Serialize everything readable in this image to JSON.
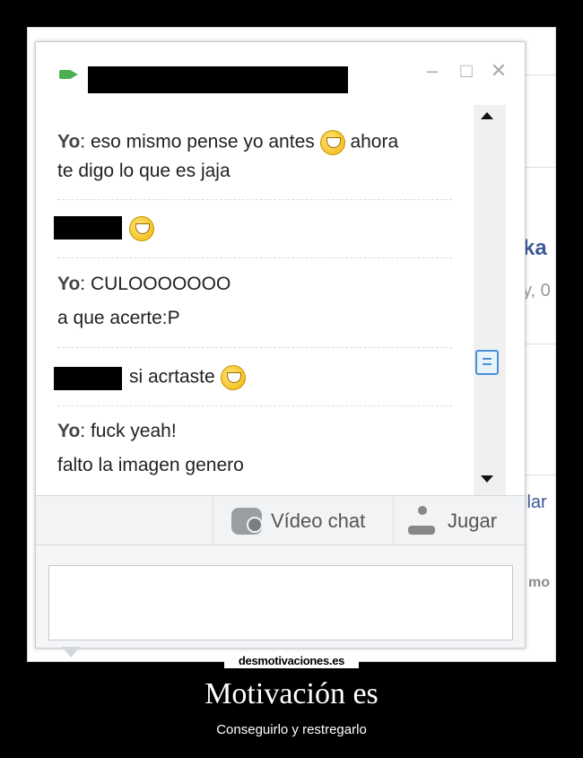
{
  "background_page": {
    "partial_heading": "ka",
    "partial_subtext": "y, 0",
    "partial_link": "llar",
    "partial_logo": "mo"
  },
  "chat_window": {
    "icons": {
      "status": "video-camera-icon",
      "minimize": "minimize-icon",
      "maximize": "maximize-icon",
      "close": "close-icon"
    },
    "messages": [
      {
        "sender": "Yo",
        "lines": [
          "eso mismo pense yo antes",
          "ahora",
          "te digo lo que es jaja"
        ]
      },
      {
        "sender": "",
        "lines": []
      },
      {
        "sender": "Yo",
        "lines": [
          "CULOOOOOOO",
          "a que acerte:P"
        ]
      },
      {
        "sender": "",
        "lines": [
          "si acrtaste"
        ]
      },
      {
        "sender": "Yo",
        "lines": [
          "fuck yeah!",
          "falto la imagen genero"
        ]
      }
    ],
    "toolbar": {
      "video_chat_label": "Vídeo chat",
      "play_label": "Jugar"
    }
  },
  "poster": {
    "site": "desmotivaciones.es",
    "title": "Motivación es",
    "subtitle": "Conseguirlo y restregarlo"
  },
  "colors": {
    "accent_blue": "#3b5998",
    "emoji_yellow": "#f0b400"
  }
}
